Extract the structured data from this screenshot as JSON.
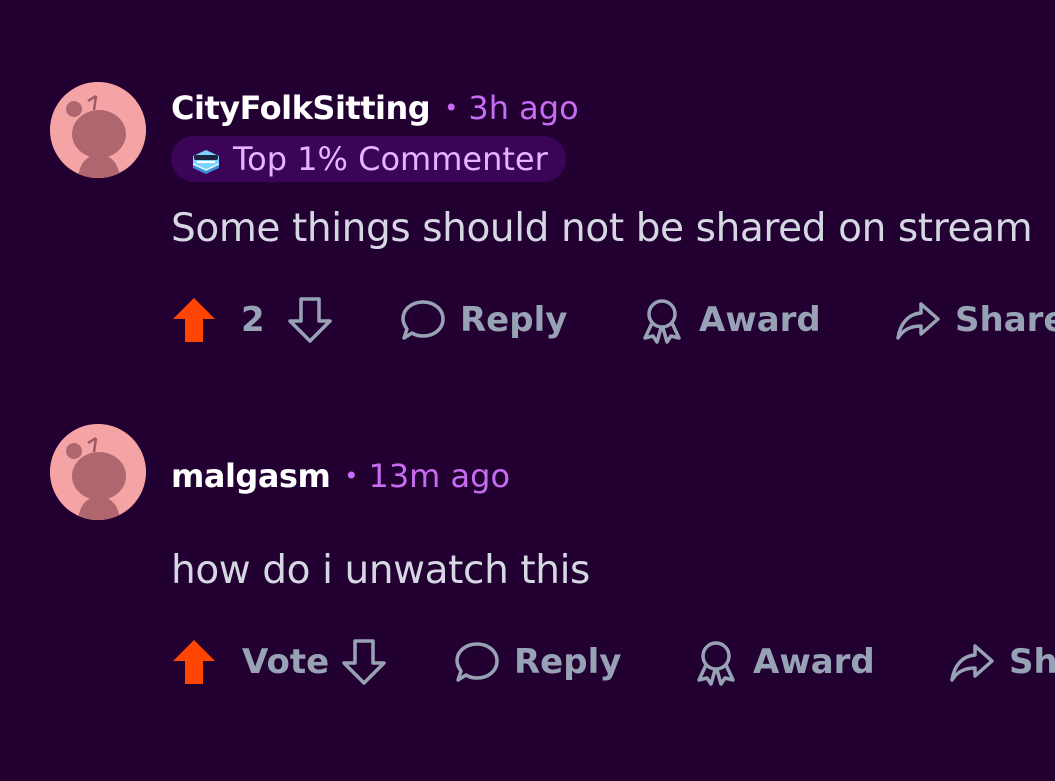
{
  "accent_color": "#c56cf0",
  "upvote_color": "#ff4500",
  "comments": [
    {
      "author": "CityFolkSitting",
      "separator": "•",
      "time": "3h ago",
      "flair": {
        "icon": "sunglasses-emoji-icon",
        "text": "Top 1% Commenter"
      },
      "body": "Some things should not be shared on stream",
      "actions": {
        "score": "2",
        "reply_label": "Reply",
        "award_label": "Award",
        "share_label": "Share"
      }
    },
    {
      "author": "malgasm",
      "separator": "•",
      "time": "13m ago",
      "body": "how do i unwatch this",
      "actions": {
        "score": "Vote",
        "reply_label": "Reply",
        "award_label": "Award",
        "share_label": "Share"
      }
    }
  ]
}
